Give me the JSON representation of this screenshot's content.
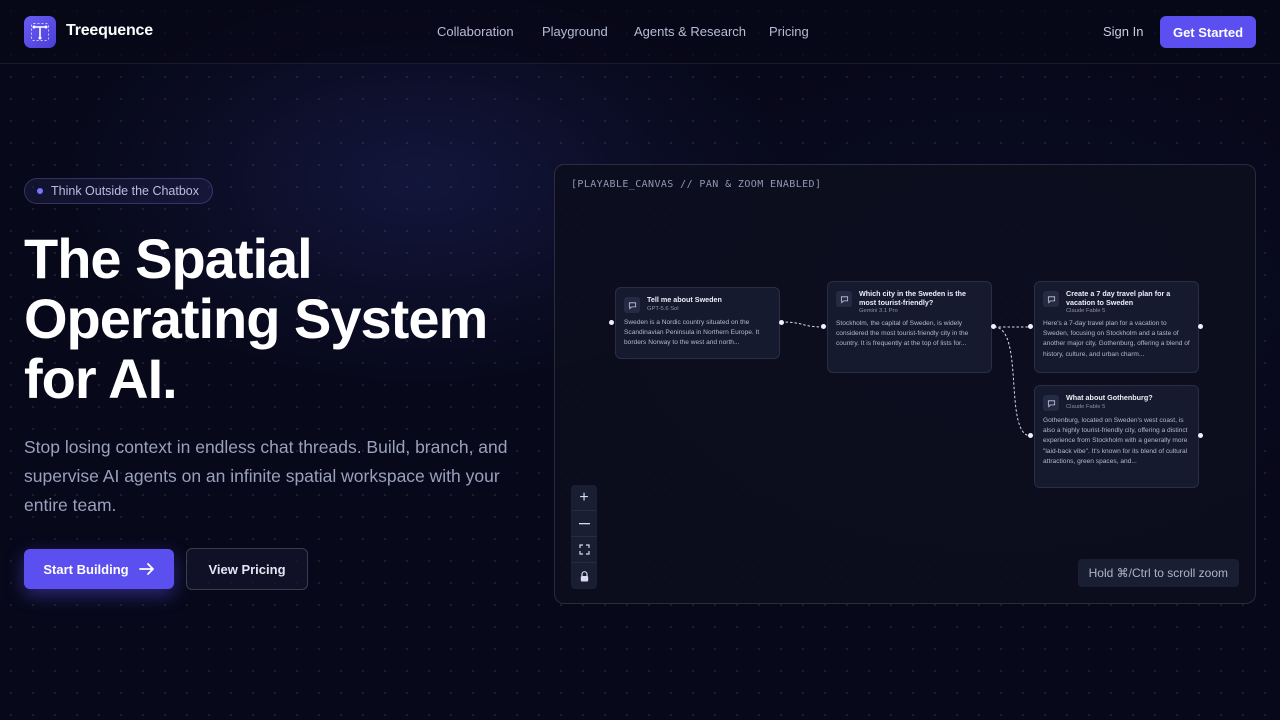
{
  "brand": {
    "name": "Treequence",
    "icon": "tree-logo-icon"
  },
  "nav": {
    "links": [
      "Collaboration",
      "Playground",
      "Agents & Research",
      "Pricing"
    ],
    "sign_in": "Sign In",
    "get_started": "Get Started"
  },
  "hero": {
    "badge": "Think Outside the Chatbox",
    "title_lines": [
      "The Spatial",
      "Operating System",
      "for AI."
    ],
    "subtitle": "Stop losing context in endless chat threads. Build, branch, and supervise AI agents on an infinite spatial workspace with your entire team.",
    "primary_cta": "Start Building",
    "secondary_cta": "View Pricing"
  },
  "canvas": {
    "label": "[PLAYABLE_CANVAS // PAN & ZOOM ENABLED]",
    "hint": "Hold ⌘/Ctrl to scroll zoom",
    "cards": [
      {
        "title": "Tell me about Sweden",
        "model": "GPT-5.6 Sol",
        "body": "Sweden is a Nordic country situated on the Scandinavian Peninsula in Northern Europe. It borders Norway to the west and north..."
      },
      {
        "title": "Which city in the Sweden is the most tourist-friendly?",
        "model": "Gemini 3.1 Pro",
        "body": "Stockholm, the capital of Sweden, is widely considered the most tourist-friendly city in the country. It is frequently at the top of lists for..."
      },
      {
        "title": "Create a 7 day travel plan for a vacation to Sweden",
        "model": "Claude Fable 5",
        "body": "Here's a 7-day travel plan for a vacation to Sweden, focusing on Stockholm and a taste of another major city, Gothenburg, offering a blend of history, culture, and urban charm..."
      },
      {
        "title": "What about Gothenburg?",
        "model": "Claude Fable 5",
        "body": "Gothenburg, located on Sweden's west coast, is also a highly tourist-friendly city, offering a distinct experience from Stockholm with a generally more \"laid-back vibe\". It's known for its blend of cultural attractions, green spaces, and..."
      }
    ],
    "zoom_controls": [
      {
        "icon": "plus-icon",
        "glyph": "+"
      },
      {
        "icon": "minus-icon",
        "glyph": "—"
      },
      {
        "icon": "fit-view-icon",
        "glyph": "⛶"
      },
      {
        "icon": "lock-icon",
        "glyph": "🔒"
      }
    ]
  }
}
